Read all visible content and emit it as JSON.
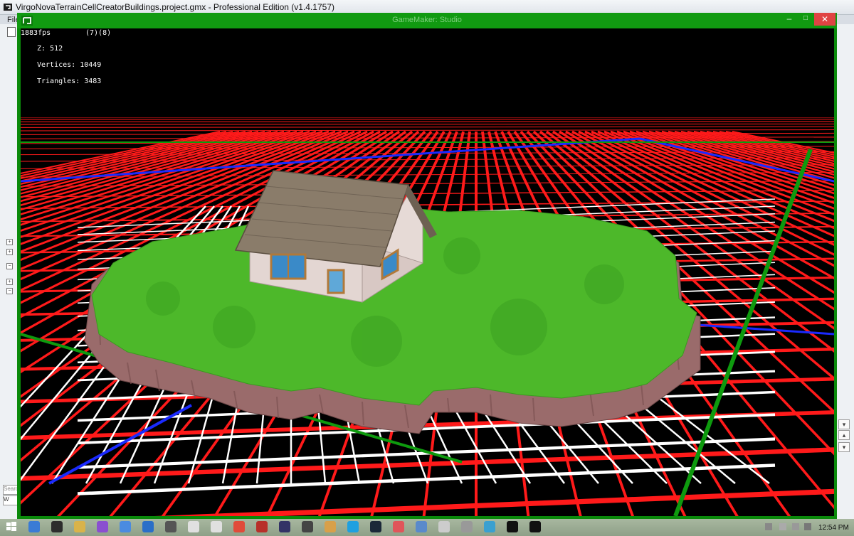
{
  "ide": {
    "title": "VirgoNovaTerrainCellCreatorBuildings.project.gmx  -  Professional Edition (v1.4.1757)",
    "menu_file": "File",
    "search_placeholder": "Search",
    "resource_item": "W",
    "window_controls": {
      "minimize": "–",
      "maximize": "□",
      "close": "✕"
    }
  },
  "game_window": {
    "title": "GameMaker: Studio",
    "controls": {
      "minimize": "–",
      "maximize": "□",
      "close": "✕"
    },
    "hud": {
      "fps": "1883fps",
      "counter": "(7)(8)",
      "z": "Z: 512",
      "vertices": "Vertices: 10449",
      "triangles": "Triangles: 3483"
    }
  },
  "taskbar": {
    "clock": "12:54 PM",
    "icons": [
      "ie-icon",
      "gm-icon",
      "folder-icon",
      "app-icon",
      "browser-icon",
      "ie2-icon",
      "media-icon",
      "save-icon",
      "save2-icon",
      "chrome-icon",
      "ladybug-icon",
      "app2-icon",
      "app3-icon",
      "app4-icon",
      "skype-icon",
      "steam-icon",
      "cat-icon",
      "app5-icon",
      "app6-icon",
      "app7-icon",
      "game-icon",
      "gm-taskbar-icon",
      "gm-runner-icon"
    ]
  },
  "colors": {
    "grid_red": "#ff1a1a",
    "grid_white": "#ffffff",
    "grid_blue": "#1a2aff",
    "grid_green": "#0e9a0e",
    "grass": "#4db82a",
    "cliff": "#9a6b6b",
    "roof": "#8a7c6a",
    "wall": "#e0d4d0"
  }
}
